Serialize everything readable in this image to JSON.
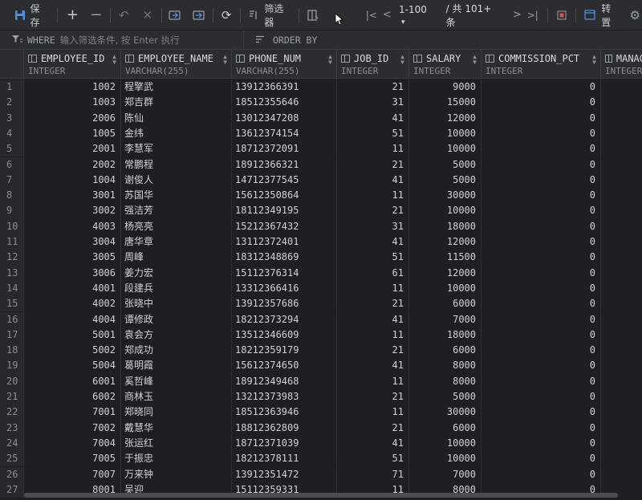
{
  "toolbar": {
    "save_label": "保存",
    "filter_label": "筛选器",
    "page_range": "1-100",
    "total_label": "/ 共 101+ 条",
    "transpose_label": "转置"
  },
  "filterbar": {
    "where_keyword": "WHERE",
    "where_placeholder": "输入筛选条件, 按 Enter 执行",
    "order_keyword": "ORDER BY"
  },
  "columns": [
    {
      "name": "EMPLOYEE_ID",
      "type": "INTEGER"
    },
    {
      "name": "EMPLOYEE_NAME",
      "type": "VARCHAR(255)"
    },
    {
      "name": "PHONE_NUM",
      "type": "VARCHAR(255)"
    },
    {
      "name": "JOB_ID",
      "type": "INTEGER"
    },
    {
      "name": "SALARY",
      "type": "INTEGER"
    },
    {
      "name": "COMMISSION_PCT",
      "type": "INTEGER"
    },
    {
      "name": "MANAG",
      "type": "INTEGER"
    }
  ],
  "rows": [
    [
      "1",
      "1002",
      "程擎武",
      "13912366391",
      "21",
      "9000",
      "0"
    ],
    [
      "2",
      "1003",
      "郑吉群",
      "18512355646",
      "31",
      "15000",
      "0"
    ],
    [
      "3",
      "2006",
      "陈仙",
      "13012347208",
      "41",
      "12000",
      "0"
    ],
    [
      "4",
      "1005",
      "金纬",
      "13612374154",
      "51",
      "10000",
      "0"
    ],
    [
      "5",
      "2001",
      "李慧军",
      "18712372091",
      "11",
      "10000",
      "0"
    ],
    [
      "6",
      "2002",
      "常鹏程",
      "18912366321",
      "21",
      "5000",
      "0"
    ],
    [
      "7",
      "1004",
      "谢俊人",
      "14712377545",
      "41",
      "5000",
      "0"
    ],
    [
      "8",
      "3001",
      "苏国华",
      "15612350864",
      "11",
      "30000",
      "0"
    ],
    [
      "9",
      "3002",
      "强洁芳",
      "18112349195",
      "21",
      "10000",
      "0"
    ],
    [
      "10",
      "4003",
      "杨亮亮",
      "15212367432",
      "31",
      "18000",
      "0"
    ],
    [
      "11",
      "3004",
      "唐华章",
      "13112372401",
      "41",
      "12000",
      "0"
    ],
    [
      "12",
      "3005",
      "周峰",
      "18312348869",
      "51",
      "11500",
      "0"
    ],
    [
      "13",
      "3006",
      "姜力宏",
      "15112376314",
      "61",
      "12000",
      "0"
    ],
    [
      "14",
      "4001",
      "段建兵",
      "13312366416",
      "11",
      "10000",
      "0"
    ],
    [
      "15",
      "4002",
      "张晓中",
      "13912357686",
      "21",
      "6000",
      "0"
    ],
    [
      "16",
      "4004",
      "谭修政",
      "18212373294",
      "41",
      "7000",
      "0"
    ],
    [
      "17",
      "5001",
      "袁会方",
      "13512346609",
      "11",
      "18000",
      "0"
    ],
    [
      "18",
      "5002",
      "郑成功",
      "18212359179",
      "21",
      "6000",
      "0"
    ],
    [
      "19",
      "5004",
      "葛明霞",
      "15612374650",
      "41",
      "8000",
      "0"
    ],
    [
      "20",
      "6001",
      "奚哲峰",
      "18912349468",
      "11",
      "8000",
      "0"
    ],
    [
      "21",
      "6002",
      "商林玉",
      "13212373983",
      "21",
      "5000",
      "0"
    ],
    [
      "22",
      "7001",
      "郑晓同",
      "18512363946",
      "11",
      "30000",
      "0"
    ],
    [
      "23",
      "7002",
      "戴慧华",
      "18812362809",
      "21",
      "6000",
      "0"
    ],
    [
      "24",
      "7004",
      "张运红",
      "18712371039",
      "41",
      "10000",
      "0"
    ],
    [
      "25",
      "7005",
      "于振忠",
      "18212378111",
      "51",
      "10000",
      "0"
    ],
    [
      "26",
      "7007",
      "万来钟",
      "13912351472",
      "71",
      "7000",
      "0"
    ],
    [
      "27",
      "8001",
      "吴迎",
      "15112359331",
      "11",
      "8000",
      "0"
    ]
  ]
}
